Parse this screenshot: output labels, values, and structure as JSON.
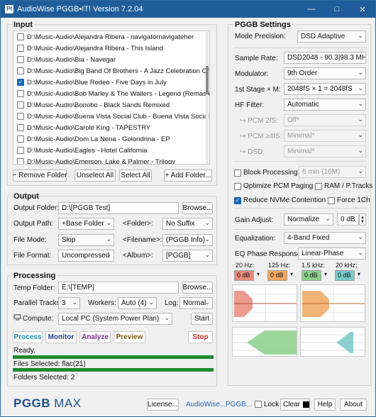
{
  "window": {
    "title": "AudioWise PGGB•IT! Version 7.2.04",
    "icon_label": "PI",
    "minimize": "—",
    "maximize": "□",
    "close": "✕"
  },
  "input": {
    "title": "Input",
    "files": [
      {
        "checked": false,
        "path": "D:\\Music-Audio\\Alejandra Ribera - navigatornavigateher"
      },
      {
        "checked": false,
        "path": "D:\\Music-Audio\\Alejandra Ribera - This Island"
      },
      {
        "checked": false,
        "path": "D:\\Music-Audio\\Bia - Navegar"
      },
      {
        "checked": false,
        "path": "D:\\Music-Audio\\Big Band Of Brothers - A Jazz Celebration Of Th"
      },
      {
        "checked": true,
        "path": "D:\\Music-Audio\\Blue Rodeo - Five Days in July"
      },
      {
        "checked": false,
        "path": "D:\\Music-Audio\\Bob Marley & The Wailers - Legend (Remastere"
      },
      {
        "checked": false,
        "path": "D:\\Music-Audio\\Bonobo - Black Sands Remixed"
      },
      {
        "checked": false,
        "path": "D:\\Music-Audio\\Buena Vista Social Club - Buena Vista Social Clu"
      },
      {
        "checked": false,
        "path": "D:\\Music-Audio\\Carole King - TAPESTRY"
      },
      {
        "checked": false,
        "path": "D:\\Music-Audio\\Dom La Nena - Golondrina - EP"
      },
      {
        "checked": false,
        "path": "D:\\Music-Audio\\Eagles - Hotel California"
      },
      {
        "checked": false,
        "path": "D:\\Music-Audio\\Emerson, Lake & Palmer - Trilogy"
      }
    ],
    "remove_folder": "− Remove Folder",
    "unselect_all": "Unselect All",
    "select_all": "Select All",
    "add_folder": "+ Add Folder..."
  },
  "output": {
    "title": "Output",
    "folder_label": "Output Folder:",
    "folder_value": "D:\\[PGGB Test]",
    "browse": "Browse...",
    "path_label": "Output Path:",
    "path_value": "+Base Folder",
    "folder_tag_label": "<Folder>:",
    "folder_tag_value": "No Suffix",
    "mode_label": "File Mode:",
    "mode_value": "Skip",
    "filename_label": "<Filename>:",
    "filename_value": "(PGGB Info)",
    "format_label": "File Format:",
    "format_value": "Uncompressed",
    "album_label": "<Album>:",
    "album_value": "[PGGB]"
  },
  "processing": {
    "title": "Processing",
    "temp_label": "Temp Folder:",
    "temp_value": "E:\\[TEMP]",
    "browse": "Browse...",
    "tracks_label": "Parallel Tracks:",
    "tracks_value": "3",
    "workers_label": "Workers:",
    "workers_value": "Auto (4)",
    "log_label": "Log:",
    "log_value": "Normal",
    "compute_label": "Compute:",
    "compute_value": "Local PC (System Power Plan)",
    "start": "Start",
    "tabs": [
      {
        "label": "Process",
        "color": "#1a8a9a"
      },
      {
        "label": "Monitor",
        "color": "#1f3f8c"
      },
      {
        "label": "Analyze",
        "color": "#7a2a8c"
      },
      {
        "label": "Preview",
        "color": "#7a5a1a"
      }
    ],
    "stop": "Stop",
    "status": "Ready.",
    "files_selected": "Files Selected: flac(21)",
    "folders_selected": "Folders Selected: 2",
    "progress1": 1.0,
    "progress2": 1.0
  },
  "settings": {
    "title": "PGGB Settings",
    "precision_label": "Mode Precision:",
    "precision_value": "DSD Adaptive",
    "sample_rate_label": "Sample Rate:",
    "sample_rate_value": "DSD2048 - 90.3|98.3 MH",
    "modulator_label": "Modulator:",
    "modulator_value": "9th Order",
    "first_stage_label": "1st Stage × M:",
    "first_stage_value": "2048fS × 1 = 2048fS",
    "hf_label": "HF Filter:",
    "hf_value": "Automatic",
    "pcm2_label": "↪ PCM 2fS:",
    "pcm2_value": "Off*",
    "pcm4_label": "↪ PCM ≥4fS:",
    "pcm4_value": "Minimal*",
    "dsd_label": "↪ DSD:",
    "dsd_value": "Minimal*",
    "block_label": "Block Processing:",
    "block_value": "6 min (16M)",
    "block_checked": false,
    "optimize_label": "Optimize PCM Paging",
    "optimize_checked": false,
    "ram_label": "RAM / P.Tracks",
    "ram_checked": false,
    "nvme_label": "Reduce NVMe Contention",
    "nvme_checked": true,
    "force_label": "Force 1Ch",
    "force_checked": false,
    "gain_label": "Gain Adjust:",
    "gain_mode": "Normalize",
    "gain_value": "0 dB",
    "eq_label": "Equalization:",
    "eq_value": "4-Band Fixed",
    "phase_label": "EQ Phase Response:",
    "phase_value": "Linear-Phase",
    "bands": [
      {
        "freq": "20 Hz:",
        "gain": "0 dB",
        "color": "#e98a7a"
      },
      {
        "freq": "125 Hz:",
        "gain": "0 dB",
        "color": "#f0a860"
      },
      {
        "freq": "1.5 kHz:",
        "gain": "0 dB",
        "color": "#8ccf8a"
      },
      {
        "freq": "20 kHz:",
        "gain": "0 dB",
        "color": "#7ac8c8"
      }
    ]
  },
  "footer": {
    "logo_bold": "PGGB",
    "logo_light": "MAX",
    "license": "License...",
    "link1": "AudioWise...",
    "link2": "PGGB...",
    "lock": "Lock",
    "clear": "Clear",
    "help": "Help",
    "about": "About"
  }
}
